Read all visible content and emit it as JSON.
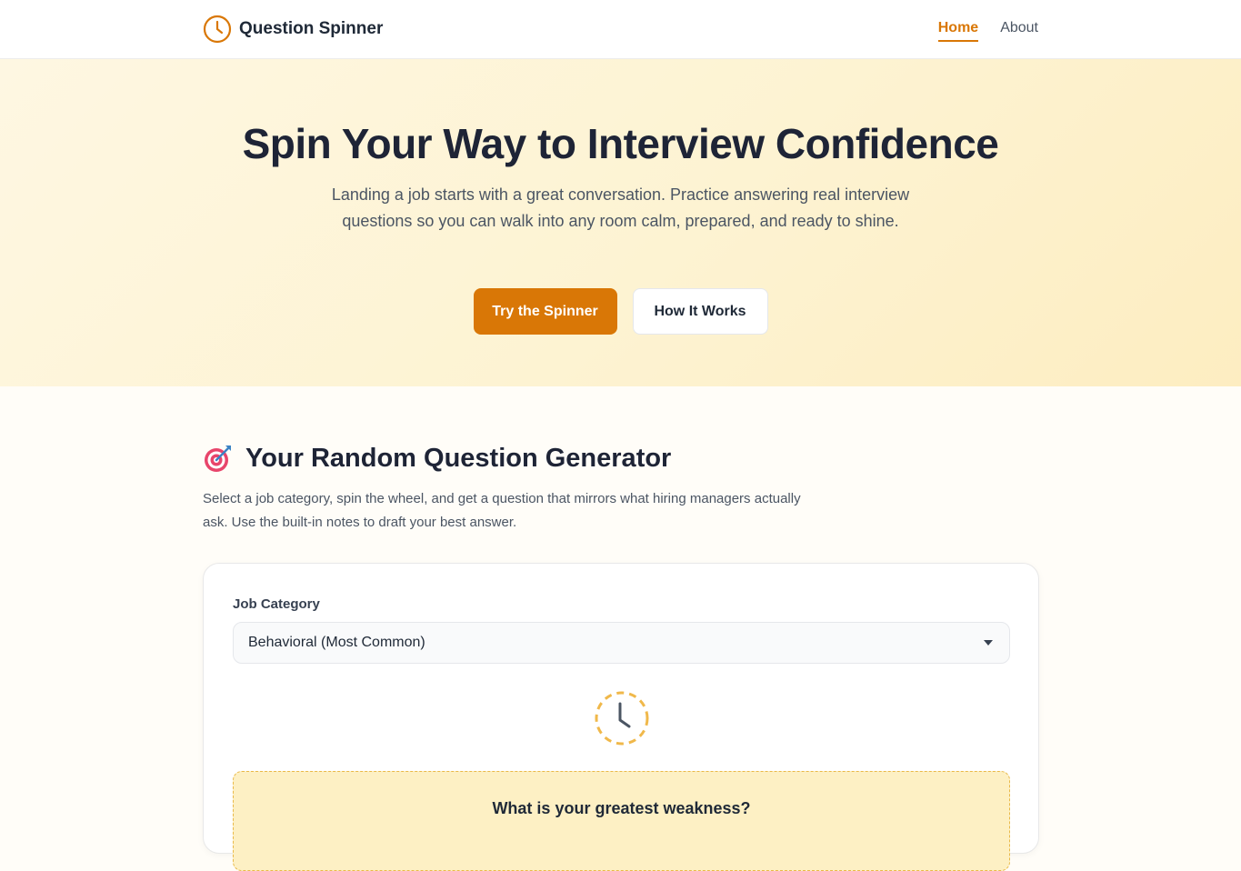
{
  "header": {
    "brand": "Question Spinner",
    "nav": [
      {
        "label": "Home",
        "active": true
      },
      {
        "label": "About",
        "active": false
      }
    ]
  },
  "hero": {
    "title": "Spin Your Way to Interview Confidence",
    "subtitle": "Landing a job starts with a great conversation. Practice answering real interview questions so you can walk into any room calm, prepared, and ready to shine.",
    "primary_button": "Try the Spinner",
    "secondary_button": "How It Works"
  },
  "generator": {
    "title": "Your Random Question Generator",
    "description": "Select a job category, spin the wheel, and get a question that mirrors what hiring managers actually ask. Use the built-in notes to draft your best answer.",
    "category_label": "Job Category",
    "category_value": "Behavioral (Most Common)",
    "question": "What is your greatest weakness?"
  },
  "colors": {
    "accent": "#d97706",
    "hero_bg": "#fef7e2",
    "question_bg": "#fdf0c4"
  },
  "icons": {
    "brand": "clock-icon",
    "section": "target-dart-icon",
    "spinner": "clock-spinner-icon",
    "select": "chevron-down-icon"
  }
}
